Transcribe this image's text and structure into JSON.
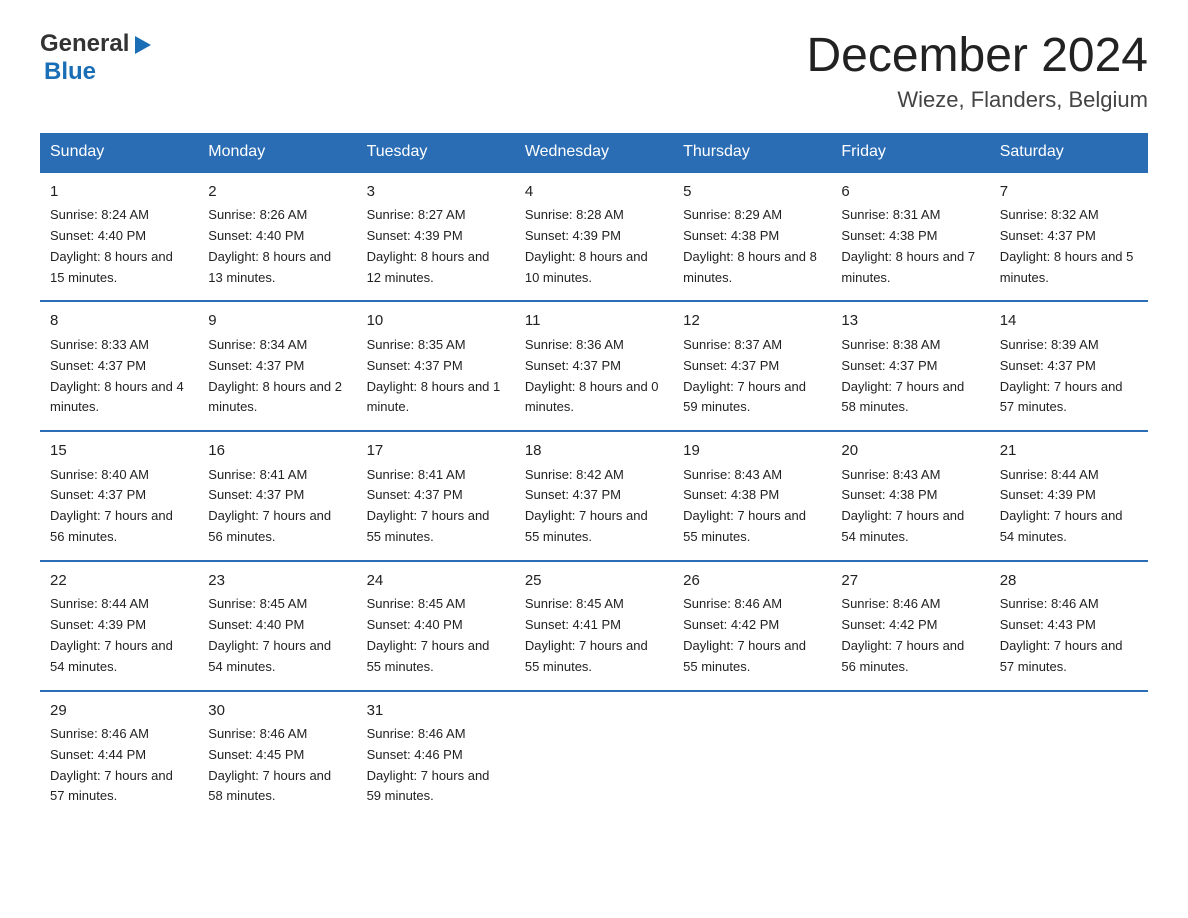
{
  "logo": {
    "general": "General",
    "blue": "Blue"
  },
  "title": {
    "month": "December 2024",
    "location": "Wieze, Flanders, Belgium"
  },
  "days_of_week": [
    "Sunday",
    "Monday",
    "Tuesday",
    "Wednesday",
    "Thursday",
    "Friday",
    "Saturday"
  ],
  "weeks": [
    [
      {
        "date": "1",
        "sunrise": "Sunrise: 8:24 AM",
        "sunset": "Sunset: 4:40 PM",
        "daylight": "Daylight: 8 hours and 15 minutes."
      },
      {
        "date": "2",
        "sunrise": "Sunrise: 8:26 AM",
        "sunset": "Sunset: 4:40 PM",
        "daylight": "Daylight: 8 hours and 13 minutes."
      },
      {
        "date": "3",
        "sunrise": "Sunrise: 8:27 AM",
        "sunset": "Sunset: 4:39 PM",
        "daylight": "Daylight: 8 hours and 12 minutes."
      },
      {
        "date": "4",
        "sunrise": "Sunrise: 8:28 AM",
        "sunset": "Sunset: 4:39 PM",
        "daylight": "Daylight: 8 hours and 10 minutes."
      },
      {
        "date": "5",
        "sunrise": "Sunrise: 8:29 AM",
        "sunset": "Sunset: 4:38 PM",
        "daylight": "Daylight: 8 hours and 8 minutes."
      },
      {
        "date": "6",
        "sunrise": "Sunrise: 8:31 AM",
        "sunset": "Sunset: 4:38 PM",
        "daylight": "Daylight: 8 hours and 7 minutes."
      },
      {
        "date": "7",
        "sunrise": "Sunrise: 8:32 AM",
        "sunset": "Sunset: 4:37 PM",
        "daylight": "Daylight: 8 hours and 5 minutes."
      }
    ],
    [
      {
        "date": "8",
        "sunrise": "Sunrise: 8:33 AM",
        "sunset": "Sunset: 4:37 PM",
        "daylight": "Daylight: 8 hours and 4 minutes."
      },
      {
        "date": "9",
        "sunrise": "Sunrise: 8:34 AM",
        "sunset": "Sunset: 4:37 PM",
        "daylight": "Daylight: 8 hours and 2 minutes."
      },
      {
        "date": "10",
        "sunrise": "Sunrise: 8:35 AM",
        "sunset": "Sunset: 4:37 PM",
        "daylight": "Daylight: 8 hours and 1 minute."
      },
      {
        "date": "11",
        "sunrise": "Sunrise: 8:36 AM",
        "sunset": "Sunset: 4:37 PM",
        "daylight": "Daylight: 8 hours and 0 minutes."
      },
      {
        "date": "12",
        "sunrise": "Sunrise: 8:37 AM",
        "sunset": "Sunset: 4:37 PM",
        "daylight": "Daylight: 7 hours and 59 minutes."
      },
      {
        "date": "13",
        "sunrise": "Sunrise: 8:38 AM",
        "sunset": "Sunset: 4:37 PM",
        "daylight": "Daylight: 7 hours and 58 minutes."
      },
      {
        "date": "14",
        "sunrise": "Sunrise: 8:39 AM",
        "sunset": "Sunset: 4:37 PM",
        "daylight": "Daylight: 7 hours and 57 minutes."
      }
    ],
    [
      {
        "date": "15",
        "sunrise": "Sunrise: 8:40 AM",
        "sunset": "Sunset: 4:37 PM",
        "daylight": "Daylight: 7 hours and 56 minutes."
      },
      {
        "date": "16",
        "sunrise": "Sunrise: 8:41 AM",
        "sunset": "Sunset: 4:37 PM",
        "daylight": "Daylight: 7 hours and 56 minutes."
      },
      {
        "date": "17",
        "sunrise": "Sunrise: 8:41 AM",
        "sunset": "Sunset: 4:37 PM",
        "daylight": "Daylight: 7 hours and 55 minutes."
      },
      {
        "date": "18",
        "sunrise": "Sunrise: 8:42 AM",
        "sunset": "Sunset: 4:37 PM",
        "daylight": "Daylight: 7 hours and 55 minutes."
      },
      {
        "date": "19",
        "sunrise": "Sunrise: 8:43 AM",
        "sunset": "Sunset: 4:38 PM",
        "daylight": "Daylight: 7 hours and 55 minutes."
      },
      {
        "date": "20",
        "sunrise": "Sunrise: 8:43 AM",
        "sunset": "Sunset: 4:38 PM",
        "daylight": "Daylight: 7 hours and 54 minutes."
      },
      {
        "date": "21",
        "sunrise": "Sunrise: 8:44 AM",
        "sunset": "Sunset: 4:39 PM",
        "daylight": "Daylight: 7 hours and 54 minutes."
      }
    ],
    [
      {
        "date": "22",
        "sunrise": "Sunrise: 8:44 AM",
        "sunset": "Sunset: 4:39 PM",
        "daylight": "Daylight: 7 hours and 54 minutes."
      },
      {
        "date": "23",
        "sunrise": "Sunrise: 8:45 AM",
        "sunset": "Sunset: 4:40 PM",
        "daylight": "Daylight: 7 hours and 54 minutes."
      },
      {
        "date": "24",
        "sunrise": "Sunrise: 8:45 AM",
        "sunset": "Sunset: 4:40 PM",
        "daylight": "Daylight: 7 hours and 55 minutes."
      },
      {
        "date": "25",
        "sunrise": "Sunrise: 8:45 AM",
        "sunset": "Sunset: 4:41 PM",
        "daylight": "Daylight: 7 hours and 55 minutes."
      },
      {
        "date": "26",
        "sunrise": "Sunrise: 8:46 AM",
        "sunset": "Sunset: 4:42 PM",
        "daylight": "Daylight: 7 hours and 55 minutes."
      },
      {
        "date": "27",
        "sunrise": "Sunrise: 8:46 AM",
        "sunset": "Sunset: 4:42 PM",
        "daylight": "Daylight: 7 hours and 56 minutes."
      },
      {
        "date": "28",
        "sunrise": "Sunrise: 8:46 AM",
        "sunset": "Sunset: 4:43 PM",
        "daylight": "Daylight: 7 hours and 57 minutes."
      }
    ],
    [
      {
        "date": "29",
        "sunrise": "Sunrise: 8:46 AM",
        "sunset": "Sunset: 4:44 PM",
        "daylight": "Daylight: 7 hours and 57 minutes."
      },
      {
        "date": "30",
        "sunrise": "Sunrise: 8:46 AM",
        "sunset": "Sunset: 4:45 PM",
        "daylight": "Daylight: 7 hours and 58 minutes."
      },
      {
        "date": "31",
        "sunrise": "Sunrise: 8:46 AM",
        "sunset": "Sunset: 4:46 PM",
        "daylight": "Daylight: 7 hours and 59 minutes."
      },
      null,
      null,
      null,
      null
    ]
  ]
}
